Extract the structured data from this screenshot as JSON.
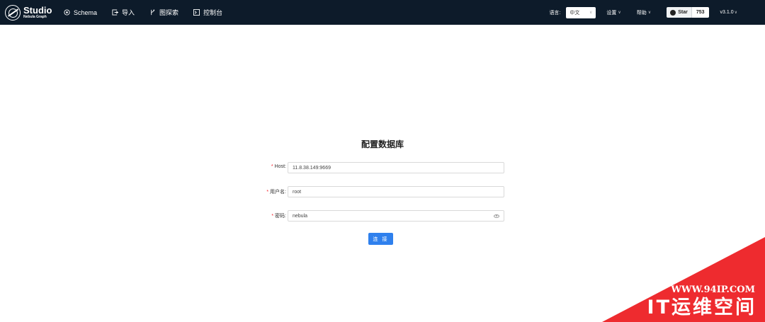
{
  "app": {
    "title": "Studio",
    "subtitle": "Nebula Graph"
  },
  "nav": [
    {
      "label": "Schema",
      "icon": "schema-icon"
    },
    {
      "label": "导入",
      "icon": "import-icon"
    },
    {
      "label": "图探索",
      "icon": "explore-icon"
    },
    {
      "label": "控制台",
      "icon": "console-icon"
    }
  ],
  "header_right": {
    "language_label": "语言:",
    "language_value": "中文",
    "settings_label": "设置",
    "help_label": "帮助",
    "github_star_label": "Star",
    "github_star_count": "753",
    "version": "v3.1.0"
  },
  "form": {
    "title": "配置数据库",
    "fields": {
      "host": {
        "label": "Host",
        "value": "11.8.38.149:9669"
      },
      "username": {
        "label": "用户名",
        "value": "root"
      },
      "password": {
        "label": "密码",
        "value": "nebula"
      }
    },
    "submit_label": "连 接"
  },
  "watermark": {
    "url": "WWW.94IP.COM",
    "name": "IT运维空间"
  },
  "colors": {
    "header_bg": "#0d1b2a",
    "primary": "#2f80ed",
    "required": "#f5222d",
    "watermark": "#ee2b2f"
  }
}
